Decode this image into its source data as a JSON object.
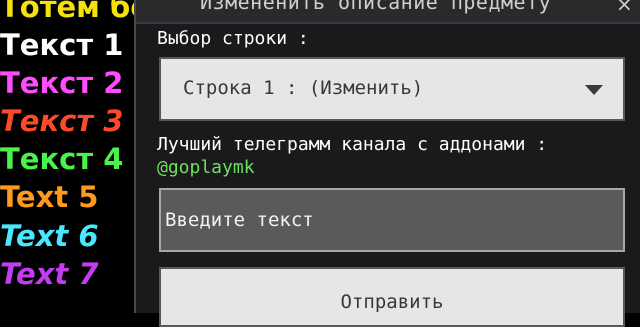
{
  "lore": {
    "lines": [
      {
        "text": "Тотем бе",
        "color": "#f5e10c",
        "italic": false
      },
      {
        "text": "Текст 1",
        "color": "#ffffff",
        "italic": false
      },
      {
        "text": "Текст 2",
        "color": "#ff4cff",
        "italic": false
      },
      {
        "text": "Текст 3",
        "color": "#ff4a2a",
        "italic": true
      },
      {
        "text": "Текст 4",
        "color": "#4cf24c",
        "italic": false
      },
      {
        "text": "Text 5",
        "color": "#ff9a1a",
        "italic": false
      },
      {
        "text": "Text 6",
        "color": "#4ae8ff",
        "italic": true
      },
      {
        "text": "Text 7",
        "color": "#c23cf0",
        "italic": true
      }
    ]
  },
  "dialog": {
    "title": "Измененить описание предмету",
    "close_symbol": "×",
    "row_select_label": "Выбор строки :",
    "row_select_value": "Строка 1 : (Изменить)",
    "promo_label": "Лучший телеграмм канала с аддонами :",
    "promo_link": "@goplaymk",
    "text_input_placeholder": "Введите текст",
    "submit_label": "Отправить"
  }
}
